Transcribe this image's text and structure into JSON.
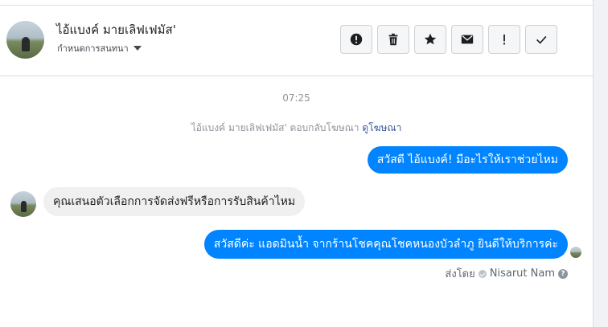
{
  "header": {
    "contact_name": "ไอ้แบงค์ มายเลิฟเฟมัส'",
    "subtitle": "กำหนดการสนทนา",
    "toolbar": [
      {
        "name": "alert-circle-icon",
        "label": "alert-circle"
      },
      {
        "name": "trash-icon",
        "label": "trash"
      },
      {
        "name": "star-icon",
        "label": "star"
      },
      {
        "name": "envelope-icon",
        "label": "envelope"
      },
      {
        "name": "exclamation-icon",
        "label": "exclamation"
      },
      {
        "name": "checkmark-icon",
        "label": "checkmark"
      }
    ]
  },
  "conversation": {
    "timestamp": "07:25",
    "system_note": "ไอ้แบงค์ มายเลิฟเฟมัส' ตอบกลับโฆษณา",
    "system_link": "ดูโฆษณา",
    "messages": [
      {
        "direction": "outgoing",
        "text": "สวัสดี ไอ้แบงค์! มีอะไรให้เราช่วยไหม"
      },
      {
        "direction": "incoming",
        "text": "คุณเสนอตัวเลือกการจัดส่งฟรีหรือการรับสินค้าไหม"
      },
      {
        "direction": "outgoing",
        "text": "สวัสดีค่ะ แอดมินน้ำ จากร้านโชคคุณโชคหนองบัวลำภู ยินดีให้บริการค่ะ"
      }
    ],
    "sent_by_label": "ส่งโดย",
    "sent_by_name": "Nisarut Nam"
  },
  "colors": {
    "accent": "#0084ff",
    "incoming_bubble": "#f1f0f0",
    "link": "#385898"
  }
}
